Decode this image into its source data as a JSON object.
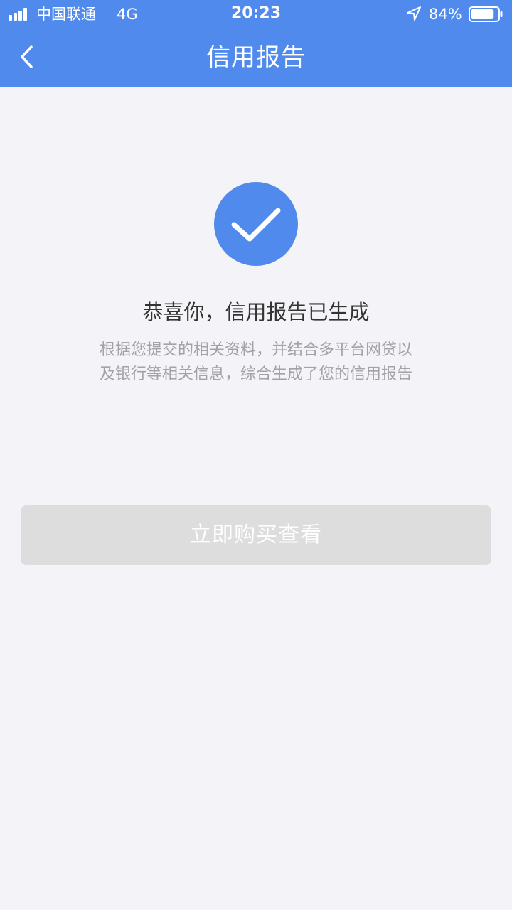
{
  "status_bar": {
    "carrier": "中国联通",
    "network": "4G",
    "time": "20:23",
    "battery_percent": "84%",
    "battery_level": 0.84,
    "signal_icon": "signal-bars-icon",
    "location_icon": "location-arrow-icon",
    "battery_icon": "battery-icon"
  },
  "nav": {
    "title": "信用报告",
    "back_icon": "chevron-left-icon"
  },
  "main": {
    "success_icon": "check-circle-icon",
    "headline": "恭喜你，信用报告已生成",
    "description_line1": "根据您提交的相关资料，并结合多平台网贷以",
    "description_line2": "及银行等相关信息，综合生成了您的信用报告",
    "button_label": "立即购买查看"
  },
  "colors": {
    "accent": "#4f8aec",
    "background": "#f4f3f7",
    "button_disabled": "#dddddd",
    "text_primary": "#333333",
    "text_secondary": "#a3a3a6"
  }
}
